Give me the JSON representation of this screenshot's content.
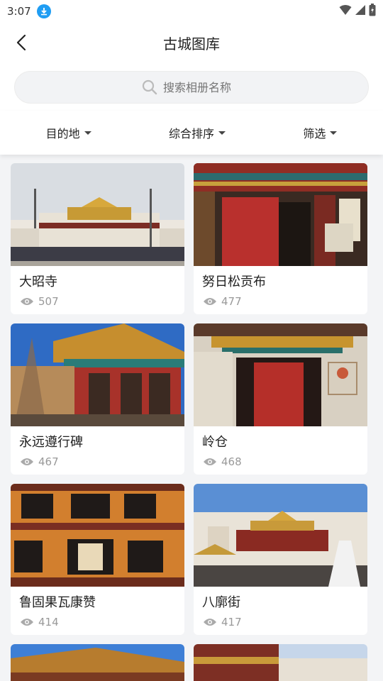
{
  "status_bar": {
    "time": "3:07"
  },
  "header": {
    "title": "古城图库"
  },
  "search": {
    "placeholder": "搜索相册名称"
  },
  "filters": [
    {
      "label": "目的地"
    },
    {
      "label": "综合排序"
    },
    {
      "label": "筛选"
    }
  ],
  "albums": [
    {
      "name": "大昭寺",
      "views": "507"
    },
    {
      "name": "努日松贡布",
      "views": "477"
    },
    {
      "name": "永远遵行碑",
      "views": "467"
    },
    {
      "name": "岭仓",
      "views": "468"
    },
    {
      "name": "鲁固果瓦康赞",
      "views": "414"
    },
    {
      "name": "八廓街",
      "views": "417"
    }
  ],
  "colors": {
    "accent": "#1f9df3",
    "background": "#f3f4f6",
    "card": "#ffffff",
    "muted": "#999999"
  }
}
